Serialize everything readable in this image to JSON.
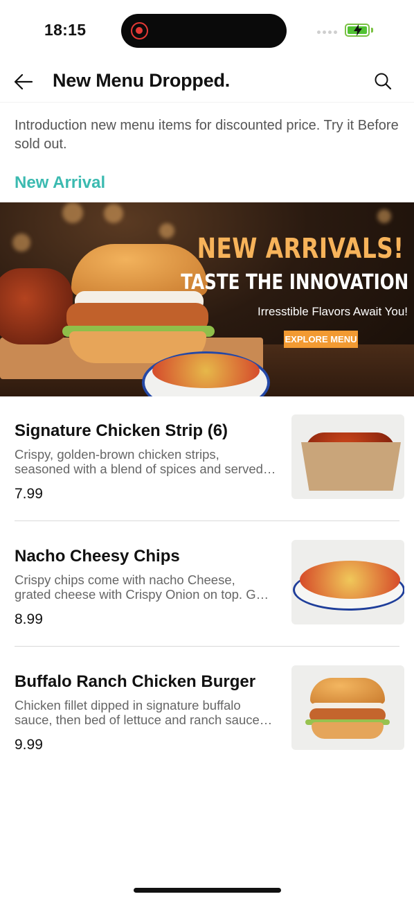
{
  "status_bar": {
    "time": "18:15",
    "recording_icon": "screen-record-icon",
    "battery_color": "#52c234"
  },
  "header": {
    "title": "New Menu Dropped.",
    "back_icon": "arrow-left-icon",
    "search_icon": "search-icon"
  },
  "intro_text": "Introduction new menu items for discounted price. Try it Before sold out.",
  "section_title": "New Arrival",
  "banner": {
    "headline_part1": "NEW ARRIVALS!",
    "headline_part2": "TASTE THE INNOVATION",
    "subtitle": "Irresstible Flavors Await You!",
    "cta": "EXPLORE MENU"
  },
  "menu_items": [
    {
      "name": "Signature Chicken Strip (6)",
      "desc_line1": "Crispy, golden-brown chicken strips,",
      "desc_line2": "seasoned with a blend of spices and served…",
      "price": "7.99"
    },
    {
      "name": "Nacho Cheesy Chips",
      "desc_line1": "Crispy chips come with nacho Cheese,",
      "desc_line2": "grated cheese with Crispy Onion on top. G…",
      "price": "8.99"
    },
    {
      "name": "Buffalo Ranch Chicken Burger",
      "desc_line1": "Chicken fillet dipped in signature buffalo",
      "desc_line2": "sauce, then bed of lettuce and ranch sauce…",
      "price": "9.99"
    }
  ],
  "colors": {
    "accent": "#3bbab0",
    "cta": "#f29a32",
    "headline_gold": "#f7b35a"
  }
}
